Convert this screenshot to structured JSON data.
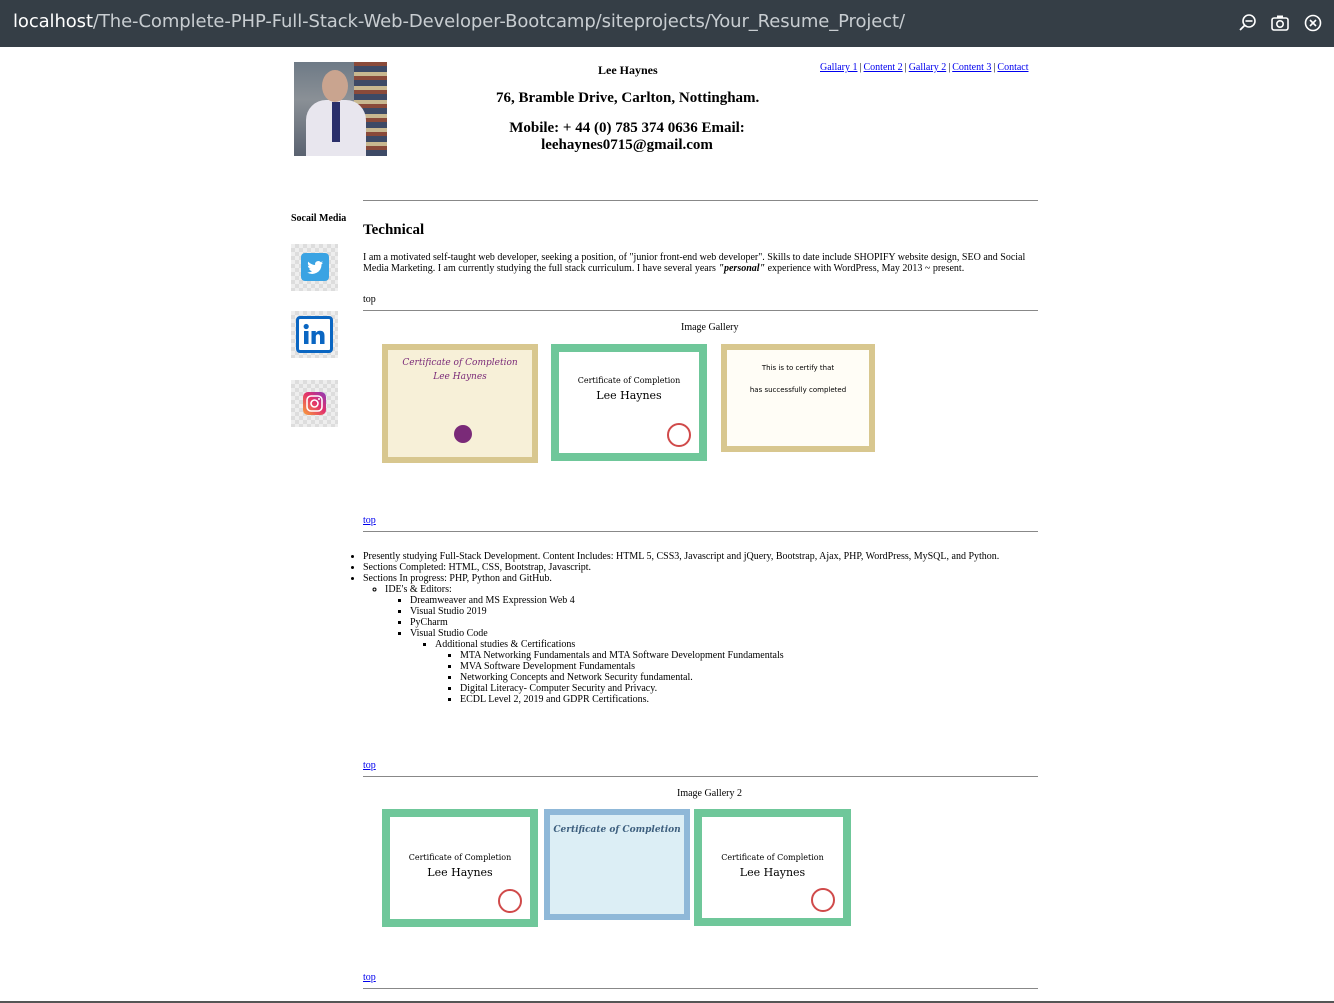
{
  "browser": {
    "url_host": "localhost",
    "url_path": "/The-Complete-PHP-Full-Stack-Web-Developer-Bootcamp/siteprojects/Your_Resume_Project/",
    "icons": [
      "zoom-out-icon",
      "camera-icon",
      "close-icon"
    ]
  },
  "header": {
    "name": "Lee Haynes",
    "address": "76, Bramble Drive, Carlton, Nottingham.",
    "contact_line1": "Mobile: + 44 (0) 785 374 0636 Email:",
    "contact_line2": "leehaynes0715@gmail.com"
  },
  "nav": {
    "links": [
      "Gallary 1",
      "Content 2",
      "Gallary 2",
      "Content 3",
      "Contact"
    ],
    "separator": "|"
  },
  "social": {
    "title": "Socail Media",
    "items": [
      "twitter-icon",
      "linkedin-icon",
      "instagram-icon"
    ]
  },
  "technical": {
    "heading": "Technical",
    "paragraph_before": "I am a motivated self-taught web developer, seeking a position, of \"junior front-end web developer\". Skills to date include SHOPIFY website design, SEO and Social Media Marketing. I am currently studying the full stack curriculum. I have several years ",
    "paragraph_emph": "\"personal\"",
    "paragraph_after": " experience with WordPress, May 2013 ~ present."
  },
  "top_label": "top",
  "gallery1": {
    "caption": "Image Gallery",
    "certs": [
      {
        "line1": "Certificate of Completion",
        "line2": "Lee Haynes"
      },
      {
        "line1": "Certificate of Completion",
        "line2": "Lee Haynes"
      },
      {
        "line1": "This is to certify that",
        "line2": "has successfully completed"
      }
    ]
  },
  "skills": {
    "items": [
      "Presently studying Full-Stack Development. Content Includes: HTML 5, CSS3, Javascript and jQuery, Bootstrap, Ajax, PHP, WordPress, MySQL, and Python.",
      "Sections Completed: HTML, CSS, Bootstrap, Javascript.",
      "Sections In progress: PHP, Python and GitHub."
    ],
    "ide_label": "IDE's & Editors:",
    "editors": [
      "Dreamweaver and MS Expression Web 4",
      "Visual Studio 2019",
      "PyCharm",
      "Visual Studio Code"
    ],
    "additional_label": "Additional studies & Certifications",
    "certifications": [
      "MTA Networking Fundamentals and MTA Software Development Fundamentals",
      "MVA Software Development Fundamentals",
      "Networking Concepts and Network Security fundamental.",
      "Digital Literacy- Computer Security and Privacy.",
      "ECDL Level 2, 2019 and GDPR Certifications."
    ]
  },
  "gallery2": {
    "caption": "Image Gallery 2",
    "certs": [
      {
        "line1": "Certificate of Completion",
        "line2": "Lee Haynes"
      },
      {
        "line1": "Certificate of Completion",
        "line2": ""
      },
      {
        "line1": "Certificate of Completion",
        "line2": "Lee Haynes"
      }
    ]
  }
}
